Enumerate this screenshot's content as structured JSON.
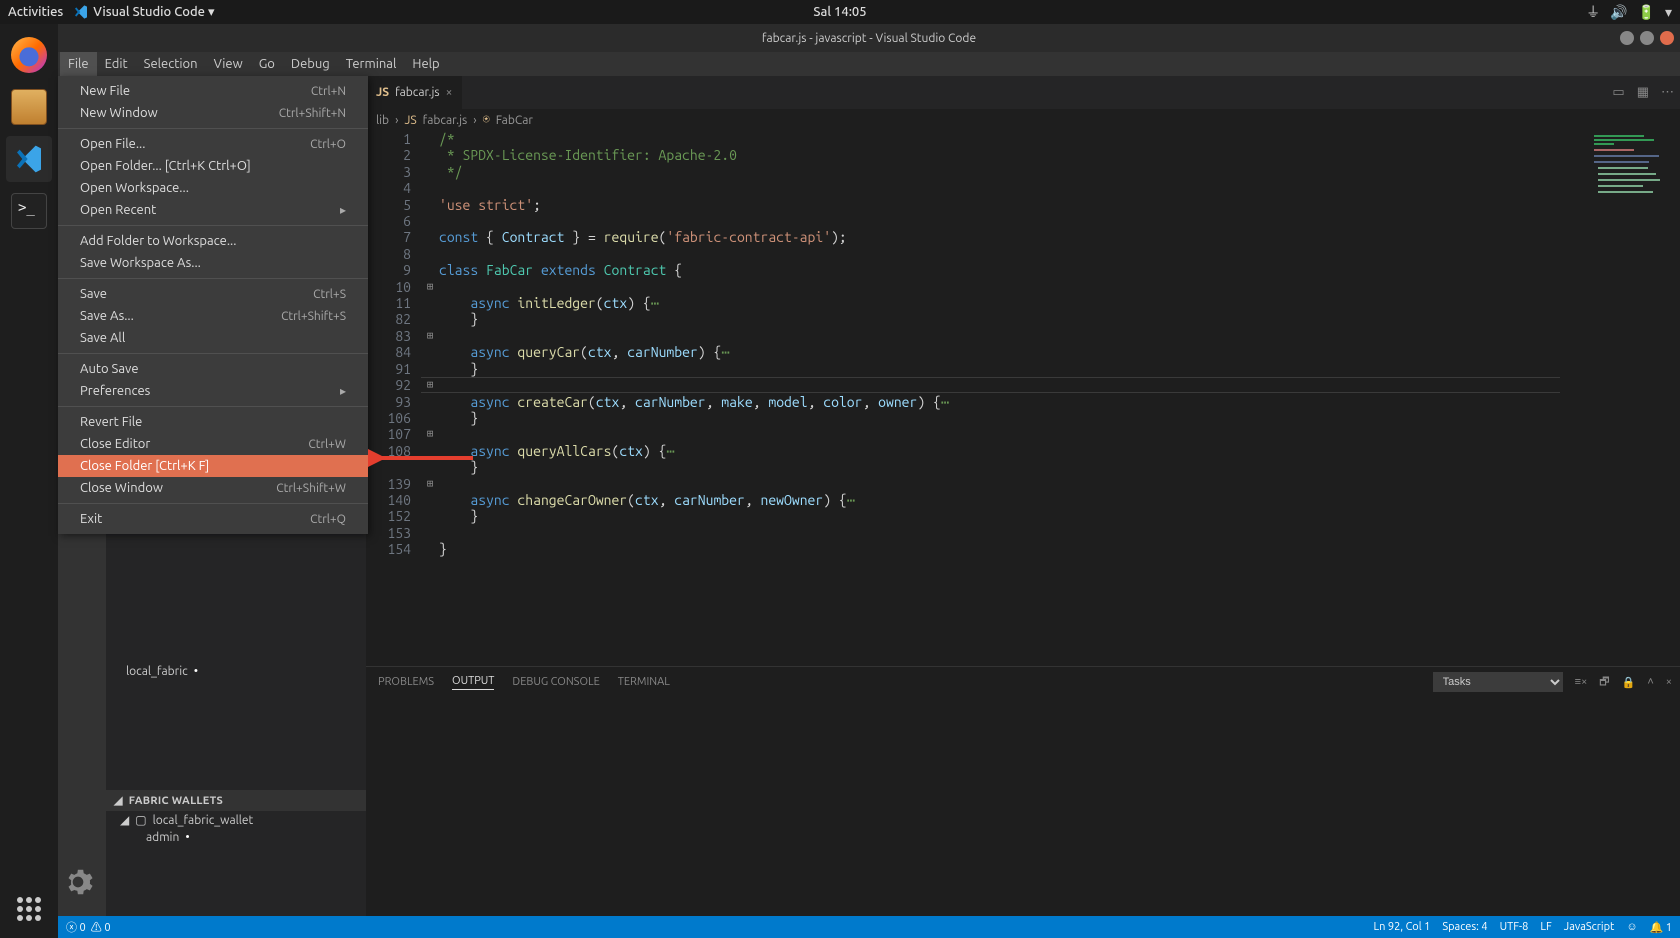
{
  "top_panel": {
    "activities": "Activities",
    "app": "Visual Studio Code ▾",
    "clock": "Sal 14:05"
  },
  "titlebar": "fabcar.js - javascript - Visual Studio Code",
  "menubar": [
    "File",
    "Edit",
    "Selection",
    "View",
    "Go",
    "Debug",
    "Terminal",
    "Help"
  ],
  "file_menu": {
    "groups": [
      [
        {
          "label": "New File",
          "shortcut": "Ctrl+N"
        },
        {
          "label": "New Window",
          "shortcut": "Ctrl+Shift+N"
        }
      ],
      [
        {
          "label": "Open File...",
          "shortcut": "Ctrl+O"
        },
        {
          "label": "Open Folder... [Ctrl+K Ctrl+O]",
          "shortcut": ""
        },
        {
          "label": "Open Workspace...",
          "shortcut": ""
        },
        {
          "label": "Open Recent",
          "shortcut": "",
          "submenu": true
        }
      ],
      [
        {
          "label": "Add Folder to Workspace...",
          "shortcut": ""
        },
        {
          "label": "Save Workspace As...",
          "shortcut": ""
        }
      ],
      [
        {
          "label": "Save",
          "shortcut": "Ctrl+S"
        },
        {
          "label": "Save As...",
          "shortcut": "Ctrl+Shift+S"
        },
        {
          "label": "Save All",
          "shortcut": ""
        }
      ],
      [
        {
          "label": "Auto Save",
          "shortcut": ""
        },
        {
          "label": "Preferences",
          "shortcut": "",
          "submenu": true
        }
      ],
      [
        {
          "label": "Revert File",
          "shortcut": ""
        },
        {
          "label": "Close Editor",
          "shortcut": "Ctrl+W"
        },
        {
          "label": "Close Folder [Ctrl+K F]",
          "shortcut": "",
          "highlighted": true
        },
        {
          "label": "Close Window",
          "shortcut": "Ctrl+Shift+W"
        }
      ],
      [
        {
          "label": "Exit",
          "shortcut": "Ctrl+Q"
        }
      ]
    ]
  },
  "sidebar": {
    "local_fabric": "local_fabric",
    "wallets_head": "FABRIC WALLETS",
    "wallet_item": "local_fabric_wallet",
    "wallet_sub": "admin"
  },
  "tab": {
    "name": "fabcar.js"
  },
  "breadcrumb": [
    "lib",
    "fabcar.js",
    "FabCar"
  ],
  "code": {
    "line_numbers": [
      1,
      2,
      3,
      4,
      5,
      6,
      7,
      8,
      9,
      10,
      11,
      82,
      83,
      84,
      91,
      92,
      93,
      106,
      107,
      108,
      "",
      139,
      140,
      152,
      153,
      154
    ],
    "fold_markers": {
      "10": "⊞",
      "13": "⊞",
      "16": "⊞",
      "19": "⊞",
      "22": "⊞"
    },
    "lines": [
      {
        "html": "<span class='c'>/*</span>"
      },
      {
        "html": "<span class='c'> * SPDX-License-Identifier: Apache-2.0</span>"
      },
      {
        "html": "<span class='c'> */</span>"
      },
      {
        "html": ""
      },
      {
        "html": "<span class='s'>'use strict'</span><span class='p'>;</span>"
      },
      {
        "html": ""
      },
      {
        "html": "<span class='k'>const</span> <span class='p'>{ </span><span class='v'>Contract</span><span class='p'> } = </span><span class='f'>require</span><span class='p'>(</span><span class='s'>'fabric-contract-api'</span><span class='p'>);</span>"
      },
      {
        "html": ""
      },
      {
        "html": "<span class='k'>class</span> <span class='t'>FabCar</span> <span class='k'>extends</span> <span class='t'>Contract</span> <span class='p'>{</span>"
      },
      {
        "html": ""
      },
      {
        "html": "    <span class='k'>async</span> <span class='f'>initLedger</span><span class='p'>(</span><span class='v'>ctx</span><span class='p'>) {</span><span class='c'>⋯</span>"
      },
      {
        "html": "    <span class='p'>}</span>"
      },
      {
        "html": ""
      },
      {
        "html": "    <span class='k'>async</span> <span class='f'>queryCar</span><span class='p'>(</span><span class='v'>ctx</span><span class='p'>, </span><span class='v'>carNumber</span><span class='p'>) {</span><span class='c'>⋯</span>"
      },
      {
        "html": "    <span class='p'>}</span>"
      },
      {
        "html": ""
      },
      {
        "html": "    <span class='k'>async</span> <span class='f'>createCar</span><span class='p'>(</span><span class='v'>ctx</span><span class='p'>, </span><span class='v'>carNumber</span><span class='p'>, </span><span class='v'>make</span><span class='p'>, </span><span class='v'>model</span><span class='p'>, </span><span class='v'>color</span><span class='p'>, </span><span class='v'>owner</span><span class='p'>) {</span><span class='c'>⋯</span>"
      },
      {
        "html": "    <span class='p'>}</span>"
      },
      {
        "html": ""
      },
      {
        "html": "    <span class='k'>async</span> <span class='f'>queryAllCars</span><span class='p'>(</span><span class='v'>ctx</span><span class='p'>) {</span><span class='c'>⋯</span>"
      },
      {
        "html": "    <span class='p'>}</span>"
      },
      {
        "html": ""
      },
      {
        "html": "    <span class='k'>async</span> <span class='f'>changeCarOwner</span><span class='p'>(</span><span class='v'>ctx</span><span class='p'>, </span><span class='v'>carNumber</span><span class='p'>, </span><span class='v'>newOwner</span><span class='p'>) {</span><span class='c'>⋯</span>"
      },
      {
        "html": "    <span class='p'>}</span>"
      },
      {
        "html": ""
      },
      {
        "html": "<span class='p'>}</span>"
      }
    ]
  },
  "panel": {
    "tabs": [
      "PROBLEMS",
      "OUTPUT",
      "DEBUG CONSOLE",
      "TERMINAL"
    ],
    "active": "OUTPUT",
    "select": "Tasks"
  },
  "status": {
    "errors": "0",
    "warnings": "0",
    "ln_col": "Ln 92, Col 1",
    "spaces": "Spaces: 4",
    "encoding": "UTF-8",
    "eol": "LF",
    "lang": "JavaScript",
    "bell": "1"
  }
}
